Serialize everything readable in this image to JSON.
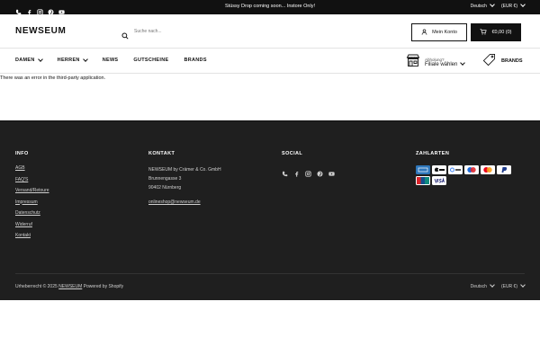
{
  "topbar": {
    "announcement": "Stüssy Drop coming soon... Instore Only!",
    "language": "Deutsch",
    "currency": "(EUR €)",
    "social_icons": [
      "phone-icon",
      "facebook-icon",
      "instagram-icon",
      "pinterest-icon",
      "youtube-icon"
    ]
  },
  "header": {
    "logo": "NEWSEUM",
    "search_placeholder": "Suche nach...",
    "account_label": "Mein Konto",
    "cart_label": "€0,00 (0)"
  },
  "nav": {
    "items": [
      {
        "label": "DAMEN",
        "dropdown": true
      },
      {
        "label": "HERREN",
        "dropdown": true
      },
      {
        "label": "NEWS",
        "dropdown": false
      },
      {
        "label": "GUTSCHEINE",
        "dropdown": false
      },
      {
        "label": "BRANDS",
        "dropdown": false
      }
    ],
    "store_small": "Abholung?",
    "store_big": "Filiale wählen",
    "brands_label": "BRANDS"
  },
  "main": {
    "error_text": "There was an error in the third-party application."
  },
  "footer": {
    "info": {
      "heading": "INFO",
      "links": [
        "AGB",
        "FAQ'S",
        "Versand/Retoure",
        "Impressum",
        "Datenschutz",
        "Widerruf",
        "Kontakt"
      ]
    },
    "kontakt": {
      "heading": "KONTAKT",
      "lines": [
        "NEWSEUM by Crämer & Co. GmbH",
        "Brunnengasse 3",
        "90402 Nürnberg"
      ],
      "email": "onlineshop@newseum.de"
    },
    "social": {
      "heading": "SOCIAL",
      "icons": [
        "phone-icon",
        "facebook-icon",
        "instagram-icon",
        "pinterest-icon",
        "youtube-icon"
      ]
    },
    "payments": {
      "heading": "ZAHLARTEN",
      "methods": [
        "American Express",
        "Apple Pay",
        "Google Pay",
        "Maestro",
        "Mastercard",
        "PayPal",
        "Union Pay",
        "Visa"
      ]
    },
    "copyright_prefix": "Urheberrecht © 2025",
    "copyright_brand": "NEWSEUM",
    "copyright_suffix": "Powered by Shopify",
    "language": "Deutsch",
    "currency": "(EUR €)"
  },
  "colors": {
    "topbar_bg": "#111111",
    "footer_bg": "#1f1f1f",
    "accent": "#111111"
  }
}
